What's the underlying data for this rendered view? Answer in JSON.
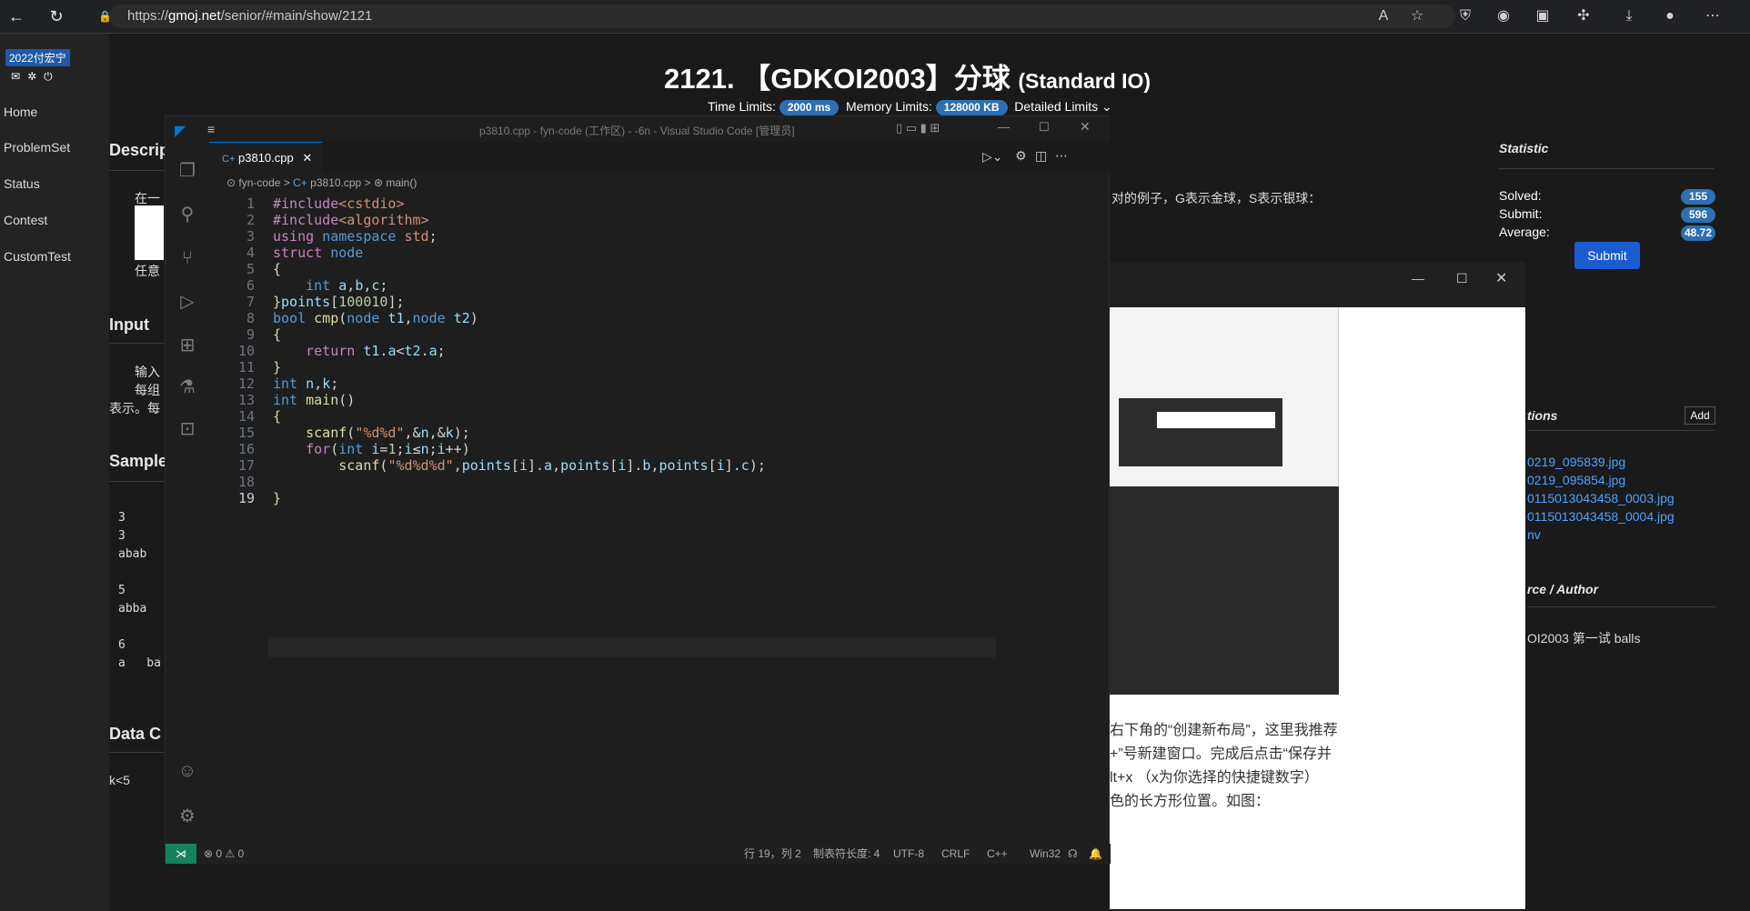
{
  "browser": {
    "url_prefix": "https://",
    "url_host": "gmoj.net",
    "url_path": "/senior/#main/show/2121"
  },
  "sidebar": {
    "user": "2022付宏宁",
    "links": [
      "Home",
      "ProblemSet",
      "Status",
      "Contest",
      "CustomTest"
    ]
  },
  "problem": {
    "title": "2121. 【GDKOI2003】分球",
    "title_suffix": "(Standard IO)",
    "time_label": "Time Limits:",
    "time_value": "2000 ms",
    "mem_label": "Memory Limits:",
    "mem_value": "128000 KB",
    "detailed": "Detailed Limits"
  },
  "sections": {
    "description": "Descrip",
    "input": "Input",
    "sample": "Sample",
    "data": "Data C"
  },
  "desc_text": {
    "a": "在一",
    "right": "对的例子，G表示金球，S表示银球："
  },
  "input_text": {
    "a": "输入",
    "b": "每组",
    "c": "表示。每"
  },
  "sample_vals": [
    "3",
    "3",
    "abab",
    "5",
    "abba",
    "6",
    "a   ba"
  ],
  "data_text": "k<5",
  "statistic": {
    "head": "Statistic",
    "solved_label": "Solved:",
    "solved": "155",
    "submit_label": "Submit:",
    "submit": "596",
    "average_label": "Average:",
    "average": "48.72",
    "button": "Submit"
  },
  "right_side": {
    "tions": "tions",
    "add": "Add",
    "files": [
      "0219_095839.jpg",
      "0219_095854.jpg",
      "0115013043458_0003.jpg",
      "0115013043458_0004.jpg",
      "nv"
    ],
    "rce": "rce / Author",
    "author_text": "OI2003 第一试 balls"
  },
  "overlay_text": [
    "右下角的“创建新布局”，这里我推荐",
    "+”号新建窗口。完成后点击“保存并",
    "lt+x （x为你选择的快捷键数字）",
    "色的长方形位置。如图："
  ],
  "vscode": {
    "window_title": "p3810.cpp - fyn-code (工作区) - -6n - Visual Studio Code [管理员]",
    "tab": "p3810.cpp",
    "crumbs": [
      "fyn-code",
      ">",
      "p3810.cpp",
      ">",
      "main()"
    ],
    "status": {
      "errors": "⊗ 0 ⚠ 0",
      "pos": "行 19，列 2",
      "tab": "制表符长度: 4",
      "enc": "UTF-8",
      "eol": "CRLF",
      "lang": "C++",
      "plat": "Win32"
    }
  },
  "colors": {
    "accent": "#2d6fb0",
    "vs_blue": "#0078d4"
  }
}
